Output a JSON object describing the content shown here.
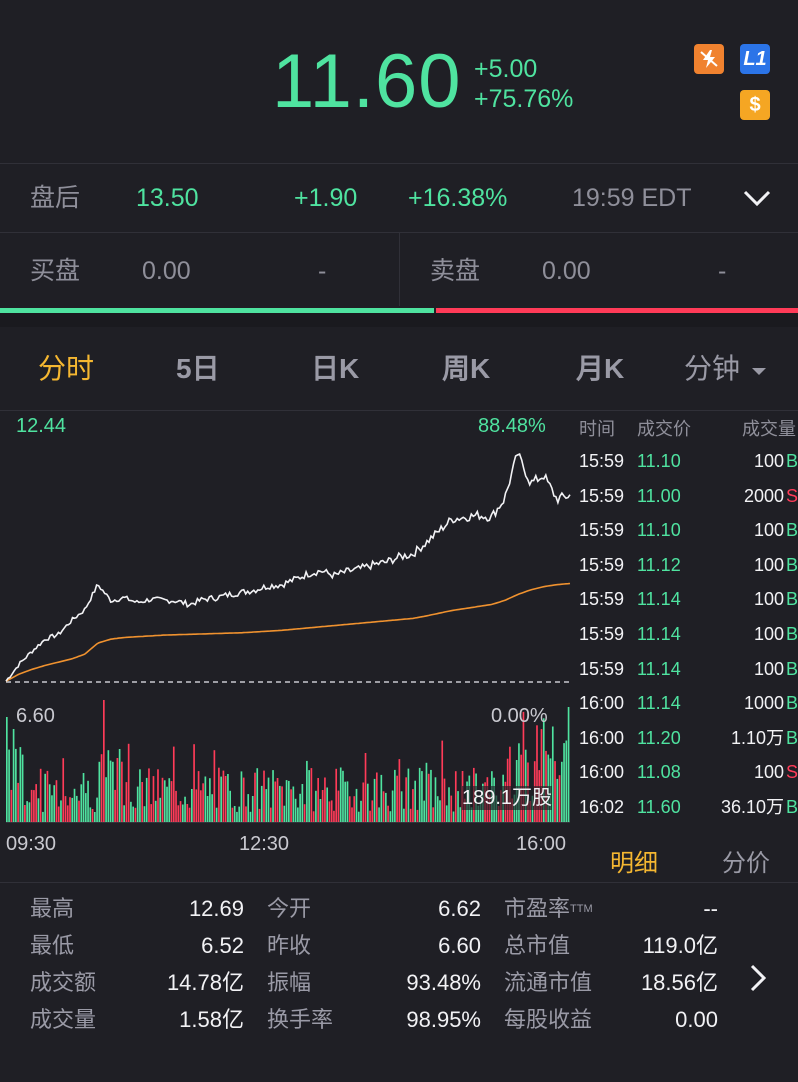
{
  "quote": {
    "price": "11.60",
    "change": "+5.00",
    "change_pct": "+75.76%",
    "badges": [
      {
        "icon": "lightning-down-icon",
        "color": "#f0822f"
      },
      {
        "text": "L1",
        "color": "#2b74e8"
      },
      {
        "text": "$",
        "color": "#f5a623"
      }
    ]
  },
  "after_hours": {
    "label": "盘后",
    "price": "13.50",
    "change": "+1.90",
    "change_pct": "+16.38%",
    "time": "19:59 EDT"
  },
  "order_book": {
    "bid_label": "买盘",
    "bid_price": "0.00",
    "bid_size": "-",
    "ask_label": "卖盘",
    "ask_price": "0.00",
    "ask_size": "-"
  },
  "bid_ask_ratio": 0.545,
  "colors": {
    "up": "#4fe3a0",
    "down": "#ff3b58",
    "accent": "#f5b731",
    "avg_line": "#f0922f"
  },
  "tabs": [
    {
      "label": "分时",
      "active": true
    },
    {
      "label": "5日",
      "active": false
    },
    {
      "label": "日K",
      "active": false
    },
    {
      "label": "周K",
      "active": false
    },
    {
      "label": "月K",
      "active": false
    },
    {
      "label": "分钟",
      "active": false,
      "dropdown": true
    }
  ],
  "chart_data": {
    "type": "line",
    "price_high_label": "12.44",
    "pct_high_label": "88.48%",
    "price_base_label": "6.60",
    "pct_base_label": "0.00%",
    "volume_label": "189.1万股",
    "x_ticks": [
      "09:30",
      "12:30",
      "16:00"
    ],
    "ylim": [
      6.6,
      12.44
    ],
    "price_series": [
      6.62,
      7.05,
      7.38,
      7.68,
      7.8,
      8.15,
      8.42,
      9.05,
      8.65,
      8.72,
      8.6,
      8.68,
      8.66,
      8.64,
      8.55,
      8.68,
      8.72,
      8.8,
      8.86,
      8.92,
      9.02,
      9.05,
      9.18,
      9.32,
      9.4,
      9.28,
      9.38,
      9.45,
      9.55,
      9.62,
      9.75,
      9.82,
      10.1,
      10.4,
      10.7,
      10.75,
      10.8,
      10.75,
      11.2,
      12.35,
      11.6,
      11.8,
      11.2,
      11.3
    ],
    "avg_series": [
      6.62,
      6.8,
      6.92,
      7.02,
      7.1,
      7.18,
      7.3,
      7.58,
      7.68,
      7.72,
      7.74,
      7.76,
      7.78,
      7.79,
      7.8,
      7.81,
      7.82,
      7.83,
      7.84,
      7.86,
      7.88,
      7.9,
      7.93,
      7.96,
      7.99,
      8.02,
      8.05,
      8.08,
      8.11,
      8.14,
      8.17,
      8.2,
      8.26,
      8.33,
      8.4,
      8.45,
      8.5,
      8.55,
      8.65,
      8.8,
      8.92,
      9.0,
      9.05,
      9.08
    ]
  },
  "trades": {
    "headers": [
      "时间",
      "成交价",
      "成交量"
    ],
    "rows": [
      {
        "time": "15:59",
        "price": "11.10",
        "vol": "100",
        "side": "B"
      },
      {
        "time": "15:59",
        "price": "11.00",
        "vol": "2000",
        "side": "S"
      },
      {
        "time": "15:59",
        "price": "11.10",
        "vol": "100",
        "side": "B"
      },
      {
        "time": "15:59",
        "price": "11.12",
        "vol": "100",
        "side": "B"
      },
      {
        "time": "15:59",
        "price": "11.14",
        "vol": "100",
        "side": "B"
      },
      {
        "time": "15:59",
        "price": "11.14",
        "vol": "100",
        "side": "B"
      },
      {
        "time": "15:59",
        "price": "11.14",
        "vol": "100",
        "side": "B"
      },
      {
        "time": "16:00",
        "price": "11.14",
        "vol": "1000",
        "side": "B"
      },
      {
        "time": "16:00",
        "price": "11.20",
        "vol": "1.10万",
        "side": "B"
      },
      {
        "time": "16:00",
        "price": "11.08",
        "vol": "100",
        "side": "S"
      },
      {
        "time": "16:02",
        "price": "11.60",
        "vol": "36.10万",
        "side": "B"
      }
    ],
    "tab_detail": "明细",
    "tab_price": "分价"
  },
  "stats": [
    [
      {
        "label": "最高",
        "value": "12.69"
      },
      {
        "label": "今开",
        "value": "6.62"
      },
      {
        "label": "市盈率TTM",
        "value": "--"
      }
    ],
    [
      {
        "label": "最低",
        "value": "6.52"
      },
      {
        "label": "昨收",
        "value": "6.60"
      },
      {
        "label": "总市值",
        "value": "119.0亿"
      }
    ],
    [
      {
        "label": "成交额",
        "value": "14.78亿"
      },
      {
        "label": "振幅",
        "value": "93.48%"
      },
      {
        "label": "流通市值",
        "value": "18.56亿"
      }
    ],
    [
      {
        "label": "成交量",
        "value": "1.58亿"
      },
      {
        "label": "换手率",
        "value": "98.95%"
      },
      {
        "label": "每股收益",
        "value": "0.00"
      }
    ]
  ]
}
